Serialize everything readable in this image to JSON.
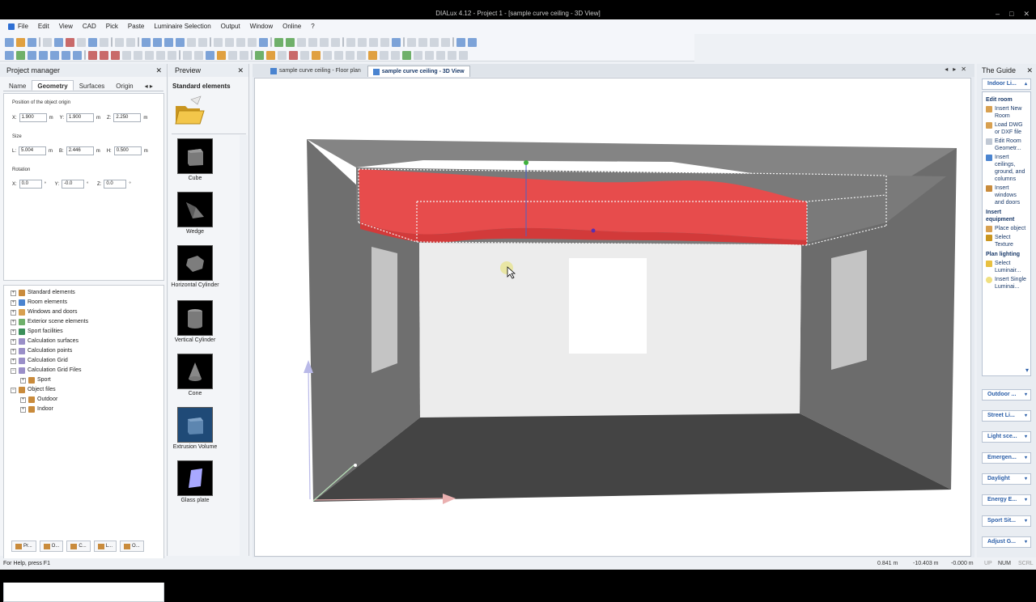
{
  "window": {
    "title": "DIALux 4.12 - Project 1 - [sample curve ceiling - 3D View]",
    "controls": [
      "–",
      "□",
      "✕"
    ]
  },
  "menu": [
    "File",
    "Edit",
    "View",
    "CAD",
    "Pick",
    "Paste",
    "Luminaire Selection",
    "Output",
    "Window",
    "Online",
    "?"
  ],
  "project_manager": {
    "title": "Project manager",
    "close": "✕",
    "tabs": [
      "Name",
      "Geometry",
      "Surfaces",
      "Origin",
      "◂ ▸"
    ],
    "active_tab": "Geometry",
    "position_label": "Position of the object origin",
    "position": {
      "x": "1.900",
      "y": "1.900",
      "z": "2.250",
      "unit": "m"
    },
    "size_label": "Size",
    "size": {
      "l": "5.004",
      "b": "2.446",
      "h": "0.500",
      "unit": "m"
    },
    "rotation_label": "Rotation",
    "rotation": {
      "x": "0.0",
      "y": "-0.0",
      "z": "0.0",
      "unit": "°"
    },
    "axis_labels": {
      "x": "X:",
      "y": "Y:",
      "z": "Z:",
      "l": "L:",
      "b": "B:",
      "h": "H:"
    },
    "tree": [
      "Standard elements",
      "Room elements",
      "Windows and doors",
      "Exterior scene elements",
      "Sport facilities",
      "Calculation surfaces",
      "Calculation points",
      "Calculation Grid",
      "Calculation Grid Files",
      "Sport",
      "Object files",
      "Outdoor",
      "Indoor"
    ],
    "bottom_tabs": [
      "Pr...",
      "O...",
      "C...",
      "L...",
      "O..."
    ]
  },
  "preview": {
    "title": "Preview",
    "close": "✕",
    "section_title": "Standard elements",
    "elements": [
      "Cube",
      "Wedge",
      "Horizontal Cylinder",
      "Vertical Cylinder",
      "Cone",
      "Extrusion Volume",
      "Glass plate"
    ]
  },
  "document": {
    "tabs": [
      "sample curve ceiling - Floor plan",
      "sample curve ceiling - 3D View"
    ],
    "active_tab": "sample curve ceiling - 3D View",
    "controls": [
      "◂",
      "▸",
      "✕"
    ]
  },
  "guide": {
    "title": "The Guide",
    "close": "✕",
    "top_button": "Indoor Li...",
    "sections": [
      {
        "title": "Edit room",
        "items": [
          "Insert New Room",
          "Load DWG or DXF file",
          "Edit Room Geometr...",
          "Insert ceilings, ground, and columns",
          "Insert windows and doors"
        ]
      },
      {
        "title": "Insert equipment",
        "items": [
          "Place object",
          "Select Texture"
        ]
      },
      {
        "title": "Plan lighting",
        "items": [
          "Select Luminair...",
          "Insert Single Luminai..."
        ]
      }
    ],
    "buttons": [
      "Outdoor ...",
      "Street Li...",
      "Light sce...",
      "Emergen...",
      "Daylight",
      "Energy E...",
      "Sport Sit...",
      "Adjust G..."
    ],
    "arrow": "▾"
  },
  "status": {
    "help": "For Help, press F1",
    "coords": [
      "0.841 m",
      "-10.403 m",
      "-0.000 m"
    ],
    "indicators": [
      "UP",
      "NUM",
      "SCRL"
    ]
  },
  "scene_colors": {
    "ceiling": "#848484",
    "left_wall": "#6f6f6f",
    "right_wall": "#6c6c6c",
    "back_wall": "#ececec",
    "floor": "#444444",
    "curved_ceiling_object": "#f04848"
  }
}
